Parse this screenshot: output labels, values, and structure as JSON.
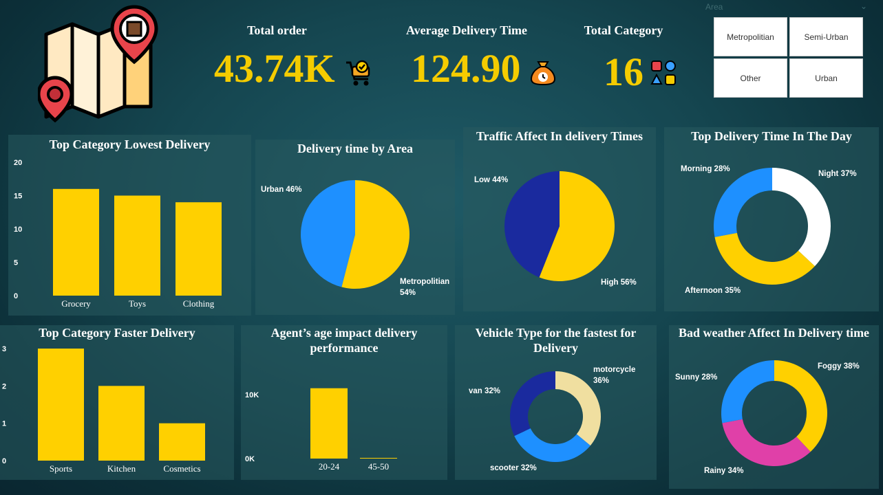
{
  "kpis": {
    "total_order": {
      "label": "Total order",
      "value": "43.74K"
    },
    "avg_delivery": {
      "label": "Average Delivery Time",
      "value": "124.90"
    },
    "total_category": {
      "label": "Total Category",
      "value": "16"
    }
  },
  "slicer": {
    "title": "Area",
    "options": [
      "Metropolitian",
      "Semi-Urban",
      "Other",
      "Urban"
    ]
  },
  "colors": {
    "yellow": "#ffd000",
    "blue": "#1e90ff",
    "navy": "#1a2a9e",
    "white": "#ffffff",
    "pink": "#e040a8",
    "cream": "#f0dfa0"
  },
  "charts": {
    "lowest_delivery": {
      "title": "Top Category Lowest Delivery",
      "chart_data": {
        "type": "bar",
        "categories": [
          "Grocery",
          "Toys",
          "Clothing"
        ],
        "values": [
          16,
          15,
          14
        ],
        "ylim": [
          0,
          20
        ],
        "yticks": [
          "0",
          "5",
          "10",
          "15",
          "20"
        ]
      }
    },
    "delivery_by_area": {
      "title": "Delivery time by Area",
      "chart_data": {
        "type": "pie",
        "labels": [
          "Metropolitian",
          "Urban"
        ],
        "values": [
          54,
          46
        ],
        "label_texts": [
          "Metropolitian",
          "54%",
          "Urban 46%"
        ]
      }
    },
    "traffic": {
      "title": "Traffic Affect In delivery Times",
      "chart_data": {
        "type": "pie",
        "labels": [
          "High",
          "Low"
        ],
        "values": [
          56,
          44
        ],
        "label_texts": [
          "High 56%",
          "Low 44%"
        ]
      }
    },
    "time_of_day": {
      "title": "Top Delivery Time In The Day",
      "chart_data": {
        "type": "pie",
        "labels": [
          "Night",
          "Afternoon",
          "Morning"
        ],
        "values": [
          37,
          35,
          28
        ],
        "label_texts": [
          "Night 37%",
          "Afternoon 35%",
          "Morning 28%"
        ]
      }
    },
    "faster_delivery": {
      "title": "Top Category Faster Delivery",
      "chart_data": {
        "type": "bar",
        "categories": [
          "Sports",
          "Kitchen",
          "Cosmetics"
        ],
        "values": [
          3,
          2,
          1
        ],
        "ylim": [
          0,
          3
        ],
        "yticks": [
          "0",
          "1",
          "2",
          "3"
        ]
      }
    },
    "agent_age": {
      "title": "Agent’s age impact delivery performance",
      "chart_data": {
        "type": "bar",
        "categories": [
          "20-24",
          "45-50"
        ],
        "values": [
          11000,
          100
        ],
        "ylim": [
          0,
          10000
        ],
        "yticks": [
          "0K",
          "10K"
        ]
      }
    },
    "vehicle": {
      "title": "Vehicle Type for the fastest for Delivery",
      "chart_data": {
        "type": "pie",
        "labels": [
          "motorcycle",
          "scooter",
          "van"
        ],
        "values": [
          36,
          32,
          32
        ],
        "label_texts": [
          "motorcycle",
          "36%",
          "scooter 32%",
          "van 32%"
        ]
      }
    },
    "weather": {
      "title": "Bad weather Affect In Delivery time",
      "chart_data": {
        "type": "pie",
        "labels": [
          "Foggy",
          "Rainy",
          "Sunny"
        ],
        "values": [
          38,
          34,
          28
        ],
        "label_texts": [
          "Foggy 38%",
          "Rainy 34%",
          "Sunny 28%"
        ]
      }
    }
  }
}
